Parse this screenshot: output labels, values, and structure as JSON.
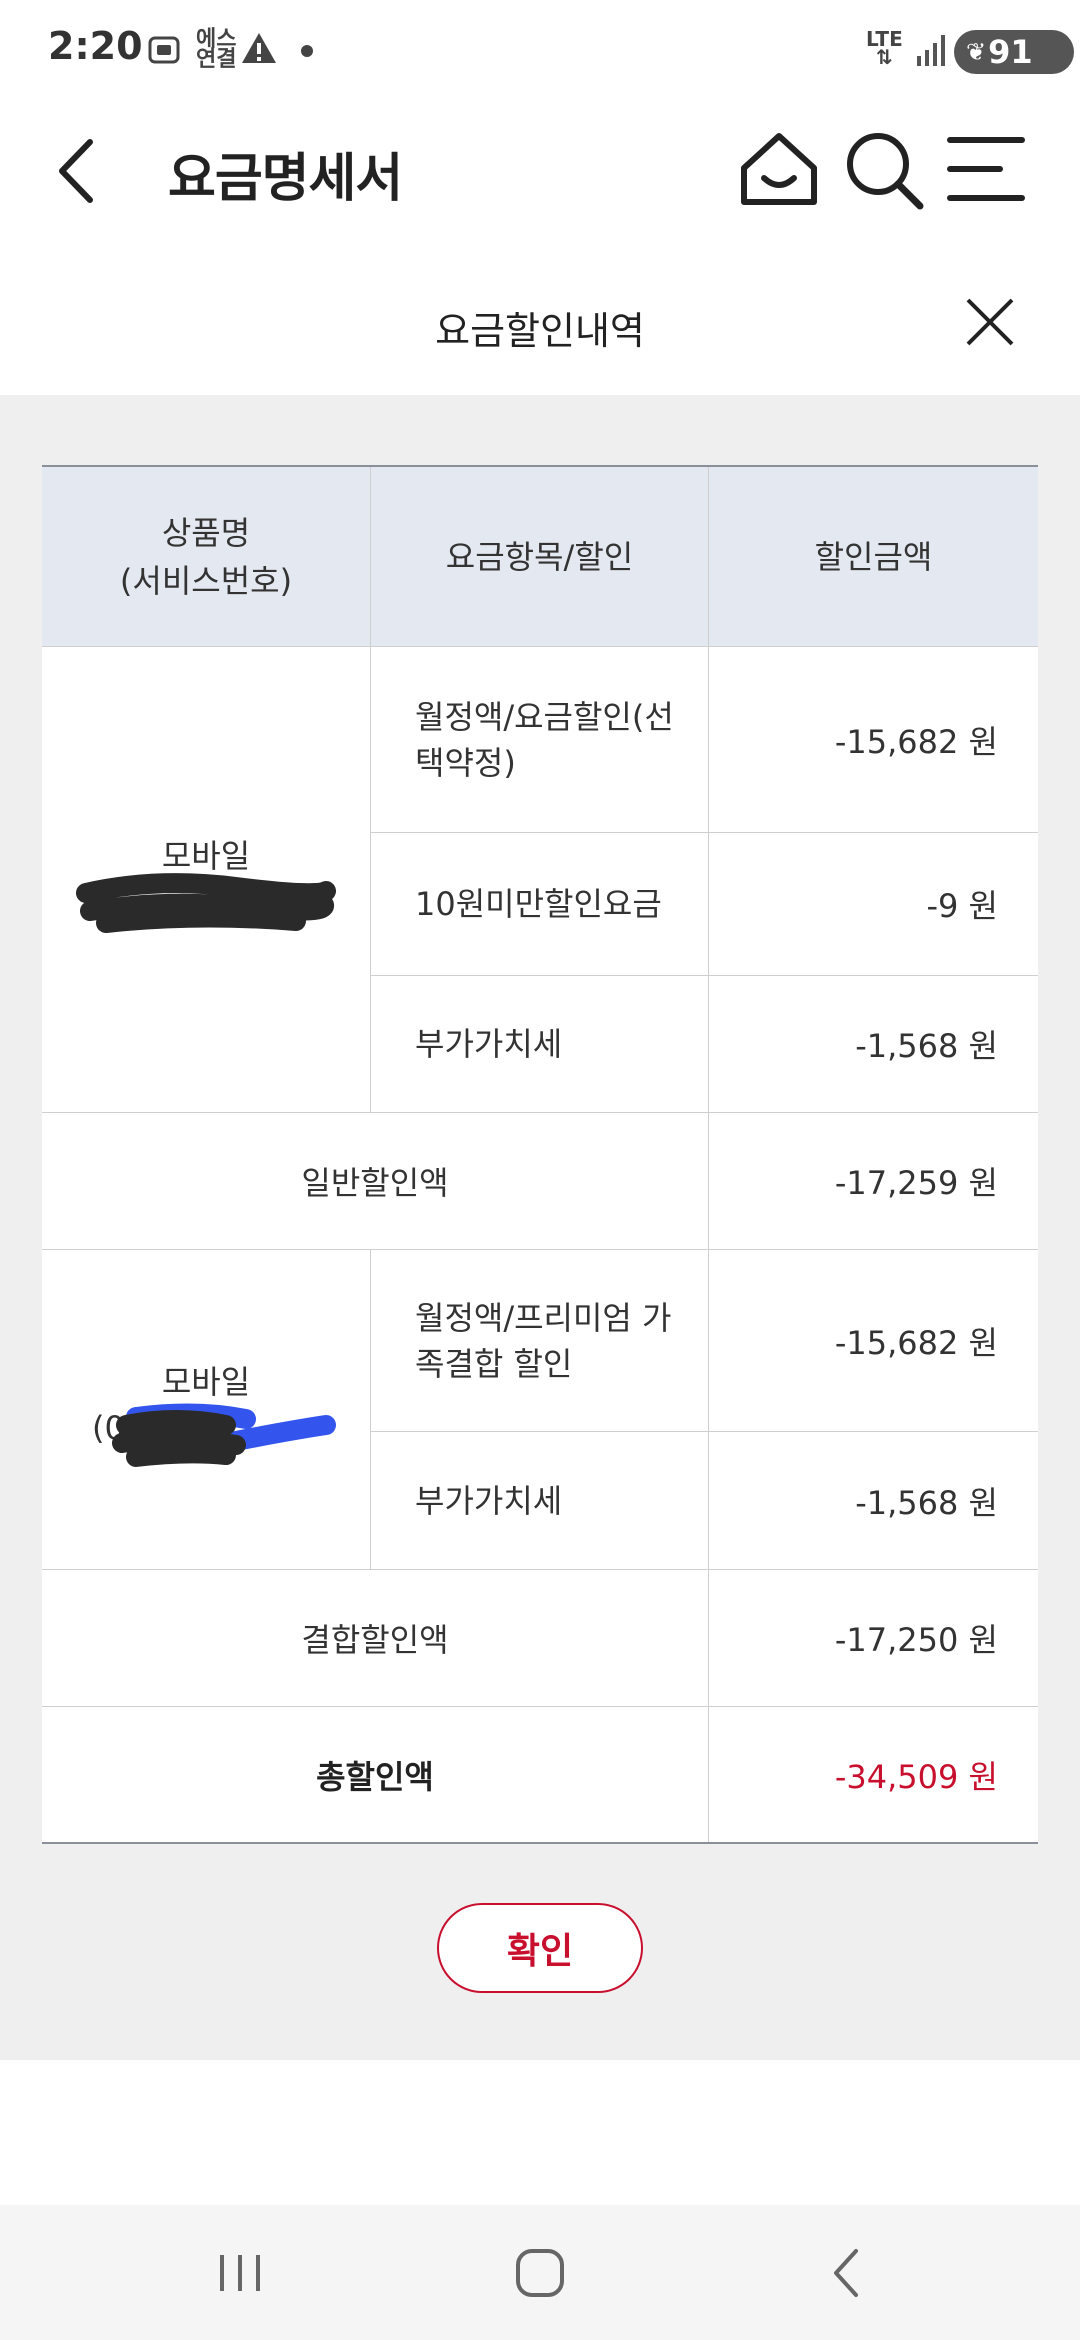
{
  "status_bar": {
    "time": "2:20",
    "icons": [
      "screenshot-icon",
      "network-text-icon",
      "warning-icon",
      "dot-icon"
    ],
    "network_label_top": "LTE",
    "battery": "91"
  },
  "header": {
    "title": "요금명세서",
    "icons": [
      "back-arrow-icon",
      "home-icon",
      "search-icon",
      "menu-icon"
    ]
  },
  "modal": {
    "title": "요금할인내역",
    "confirm_label": "확인"
  },
  "table": {
    "columns": [
      "상품명\n(서비스번호)",
      "요금항목/할인",
      "할인금액"
    ],
    "col1_line1": "상품명",
    "col1_line2": "(서비스번호)",
    "col2": "요금항목/할인",
    "col3": "할인금액",
    "groups": [
      {
        "name": "모바일",
        "service_no_visible": "(",
        "items": [
          {
            "label": "월정액/요금할인(선택약정)",
            "amount": "-15,682 원"
          },
          {
            "label": "10원미만할인요금",
            "amount": "-9 원"
          },
          {
            "label": "부가가치세",
            "amount": "-1,568 원"
          }
        ],
        "subtotal_label": "일반할인액",
        "subtotal_amount": "-17,259 원"
      },
      {
        "name": "모바일",
        "service_no_visible": "(01",
        "items": [
          {
            "label": "월정액/프리미엄 가족결합 할인",
            "amount": "-15,682 원"
          },
          {
            "label": "부가가치세",
            "amount": "-1,568 원"
          }
        ],
        "subtotal_label": "결합할인액",
        "subtotal_amount": "-17,250 원"
      }
    ],
    "total_label": "총할인액",
    "total_amount": "-34,509 원"
  },
  "colors": {
    "accent_red": "#c8102e",
    "header_bg": "#e4e9f1",
    "page_gray": "#efefef"
  }
}
